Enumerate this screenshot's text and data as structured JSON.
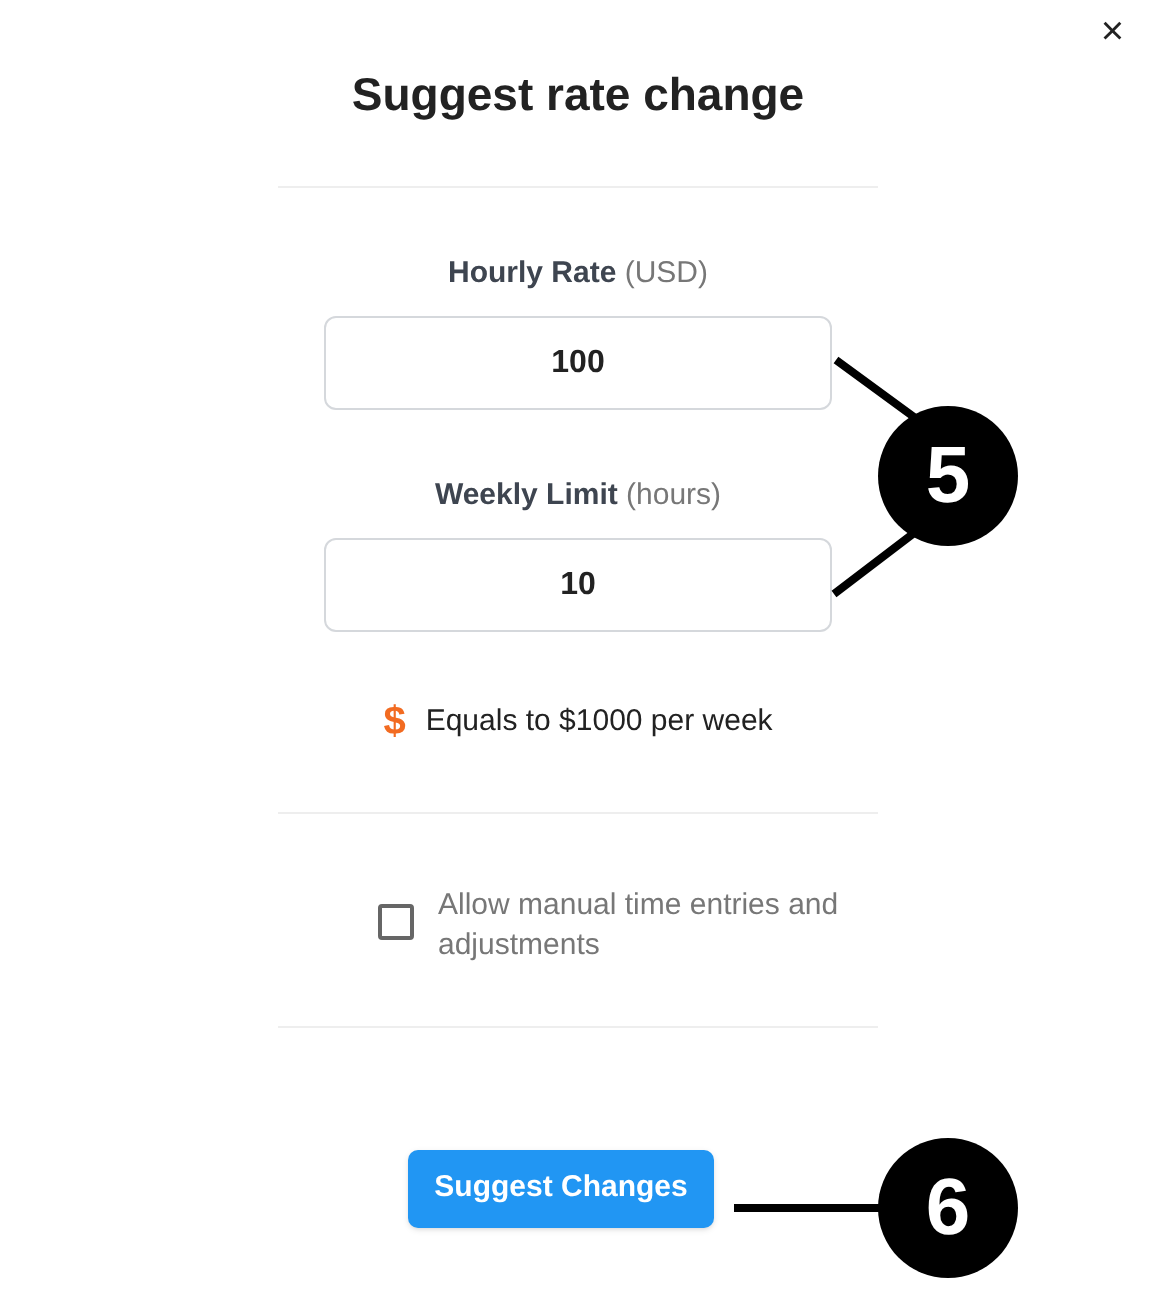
{
  "dialog": {
    "title": "Suggest rate change",
    "close": "×"
  },
  "fields": [
    {
      "label": "Hourly Rate",
      "unit": "(USD)",
      "value": "100"
    },
    {
      "label": "Weekly Limit",
      "unit": "(hours)",
      "value": "10"
    }
  ],
  "summary": {
    "icon": "$",
    "text": "Equals to $1000 per week"
  },
  "checkbox": {
    "label": "Allow manual time entries and adjustments",
    "checked": false
  },
  "submit": "Suggest Changes",
  "callouts": [
    {
      "label": "5"
    },
    {
      "label": "6"
    }
  ]
}
